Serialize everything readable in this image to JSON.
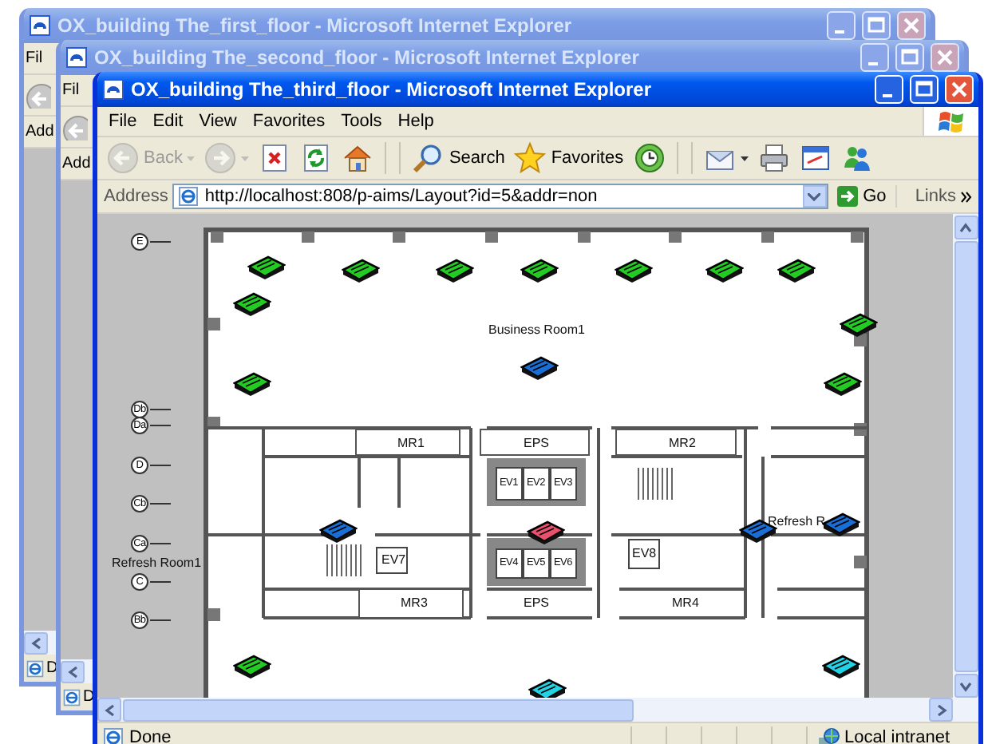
{
  "background_windows": [
    {
      "title": "OX_building The_first_floor - Microsoft Internet Explorer",
      "active": false,
      "menu_text": "Fil",
      "address_label": "Add",
      "status_text": "D"
    },
    {
      "title": "OX_building The_second_floor - Microsoft Internet Explorer",
      "active": false,
      "menu_text": "Fil",
      "address_label": "Add",
      "status_text": "D"
    }
  ],
  "browser": {
    "title": "OX_building The_third_floor - Microsoft Internet Explorer",
    "active": true,
    "menu": [
      "File",
      "Edit",
      "View",
      "Favorites",
      "Tools",
      "Help"
    ],
    "toolbar": [
      {
        "kind": "back",
        "label": "Back",
        "disabled": true
      },
      {
        "kind": "forward",
        "disabled": true
      },
      {
        "kind": "stop",
        "disabled": false
      },
      {
        "kind": "refresh",
        "disabled": false
      },
      {
        "kind": "home",
        "disabled": false
      },
      {
        "kind": "search",
        "label": "Search",
        "disabled": false
      },
      {
        "kind": "favorites",
        "label": "Favorites",
        "disabled": false
      },
      {
        "kind": "history",
        "disabled": false
      },
      {
        "kind": "mail",
        "disabled": false
      },
      {
        "kind": "print",
        "disabled": false
      },
      {
        "kind": "edit",
        "disabled": false
      },
      {
        "kind": "messenger",
        "disabled": false
      }
    ],
    "address": {
      "label": "Address",
      "url": "http://localhost:808/p-aims/Layout?id=5&addr=non"
    },
    "go": "Go",
    "links": "Links",
    "map": {
      "axis_labels": [
        "E",
        "Db",
        "Da",
        "D",
        "Cb",
        "Ca",
        "C",
        "Bb"
      ],
      "room_labels": [
        "Business Room1",
        "MR1",
        "EPS",
        "MR2",
        "EV1",
        "EV2",
        "EV3",
        "Refresh R",
        "EV7",
        "EV4",
        "EV5",
        "EV6",
        "EV8",
        "Refresh Room1",
        "MR3",
        "EPS",
        "MR4"
      ],
      "units": [
        {
          "color": "#22cc22"
        },
        {
          "color": "#22cc22"
        },
        {
          "color": "#22cc22"
        },
        {
          "color": "#22cc22"
        },
        {
          "color": "#22cc22"
        },
        {
          "color": "#22cc22"
        },
        {
          "color": "#22cc22"
        },
        {
          "color": "#22cc22"
        },
        {
          "color": "#22cc22"
        },
        {
          "color": "#1a6fd6"
        },
        {
          "color": "#22cc22"
        },
        {
          "color": "#22cc22"
        },
        {
          "color": "#1a6fd6"
        },
        {
          "color": "#e8506e"
        },
        {
          "color": "#1a6fd6"
        },
        {
          "color": "#1a6fd6"
        },
        {
          "color": "#22cc22"
        },
        {
          "color": "#22d3e6"
        },
        {
          "color": "#22d3e6"
        }
      ]
    },
    "status": {
      "text": "Done",
      "zone": "Local intranet"
    }
  }
}
